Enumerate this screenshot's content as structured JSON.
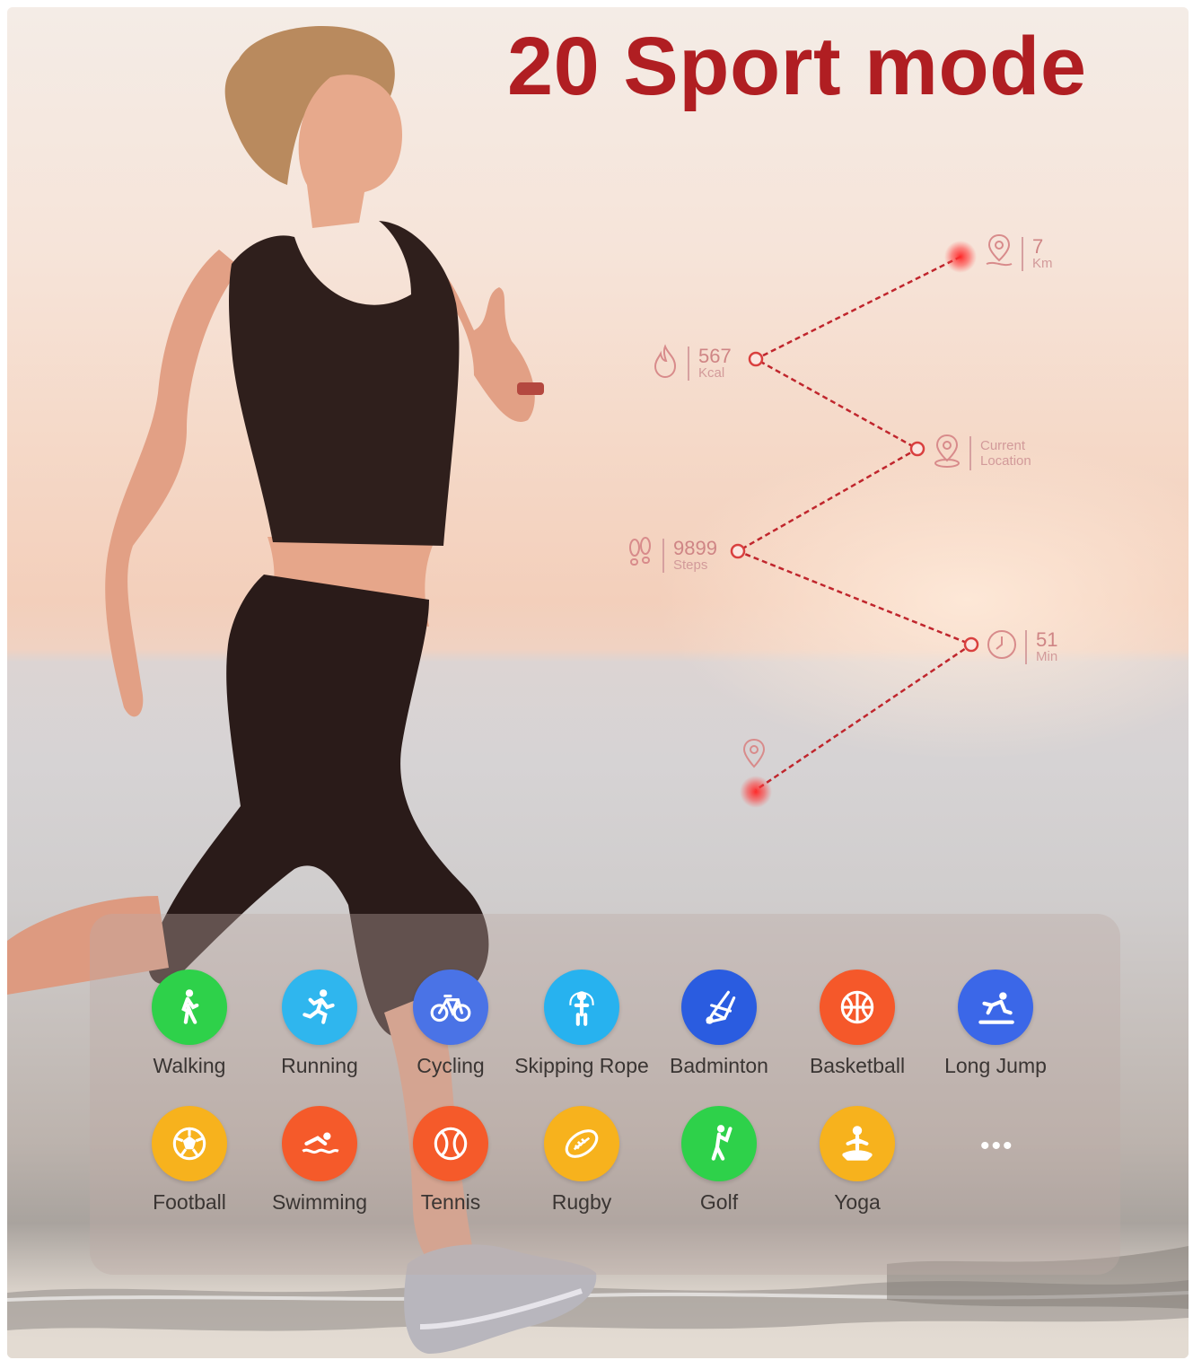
{
  "title": "20 Sport mode",
  "colors": {
    "title": "#b01e22",
    "route": "#c0262d",
    "stat_text": "#cf8585"
  },
  "stats": {
    "distance": {
      "value": "7",
      "unit": "Km",
      "icon": "map-pin-path-icon"
    },
    "calories": {
      "value": "567",
      "unit": "Kcal",
      "icon": "flame-icon"
    },
    "location": {
      "line1": "Current",
      "line2": "Location",
      "icon": "location-pin-icon"
    },
    "steps": {
      "value": "9899",
      "unit": "Steps",
      "icon": "footprints-icon"
    },
    "time": {
      "value": "51",
      "unit": "Min",
      "icon": "clock-icon"
    }
  },
  "sports": [
    {
      "name": "Walking",
      "color": "#2ed14a",
      "icon": "walking-icon"
    },
    {
      "name": "Running",
      "color": "#2fb6ee",
      "icon": "running-icon"
    },
    {
      "name": "Cycling",
      "color": "#4a73e6",
      "icon": "bicycle-icon"
    },
    {
      "name": "Skipping Rope",
      "color": "#27b2ef",
      "icon": "skipping-rope-icon"
    },
    {
      "name": "Badminton",
      "color": "#2a5ce0",
      "icon": "shuttlecock-icon"
    },
    {
      "name": "Basketball",
      "color": "#f5582a",
      "icon": "basketball-icon"
    },
    {
      "name": "Long Jump",
      "color": "#3b67e8",
      "icon": "long-jump-icon"
    },
    {
      "name": "Football",
      "color": "#f7b21d",
      "icon": "soccer-ball-icon"
    },
    {
      "name": "Swimming",
      "color": "#f55a2a",
      "icon": "swimmer-icon"
    },
    {
      "name": "Tennis",
      "color": "#f55a2a",
      "icon": "tennis-ball-icon"
    },
    {
      "name": "Rugby",
      "color": "#f7b21d",
      "icon": "rugby-ball-icon"
    },
    {
      "name": "Golf",
      "color": "#2ed14a",
      "icon": "golfer-icon"
    },
    {
      "name": "Yoga",
      "color": "#f7b21d",
      "icon": "yoga-icon"
    }
  ],
  "more_label": "•••"
}
